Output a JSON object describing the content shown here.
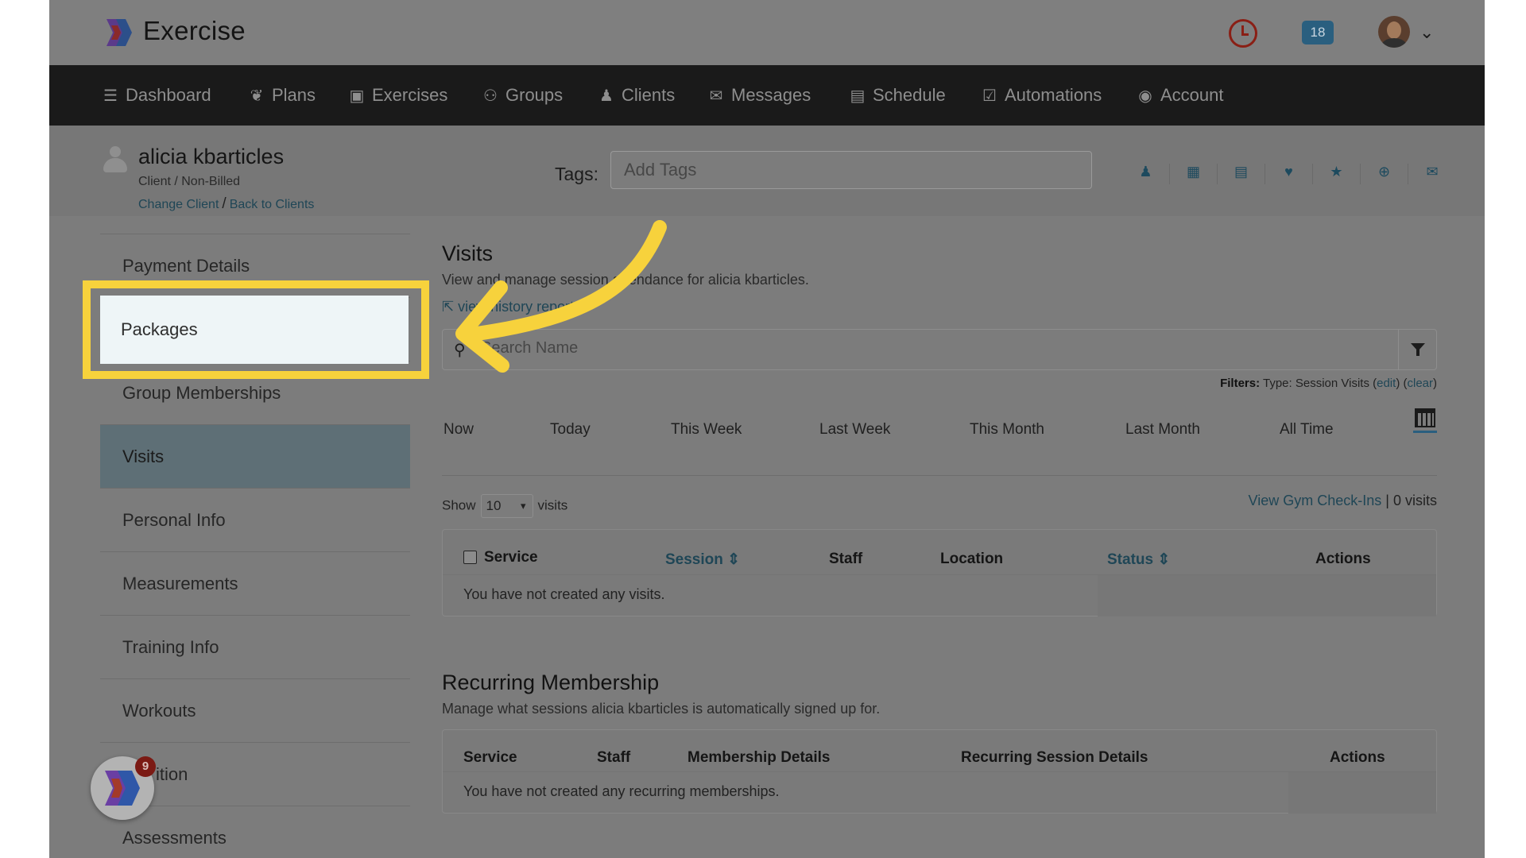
{
  "app": {
    "brand": "Exercise"
  },
  "topbar": {
    "notification_count": "18"
  },
  "nav": {
    "items": [
      {
        "label": "Dashboard",
        "icon": "list-icon"
      },
      {
        "label": "Plans",
        "icon": "bird-icon"
      },
      {
        "label": "Exercises",
        "icon": "dumbbell-icon"
      },
      {
        "label": "Groups",
        "icon": "users-icon"
      },
      {
        "label": "Clients",
        "icon": "user-icon"
      },
      {
        "label": "Messages",
        "icon": "envelope-icon"
      },
      {
        "label": "Schedule",
        "icon": "book-icon"
      },
      {
        "label": "Automations",
        "icon": "check-square-icon"
      },
      {
        "label": "Account",
        "icon": "user-circle-icon"
      }
    ]
  },
  "client": {
    "name": "alicia kbarticles",
    "type": "Client / Non-Billed",
    "change_link": "Change Client",
    "separator": "/",
    "back_link": "Back to Clients",
    "tags_label": "Tags:",
    "tags_placeholder": "Add Tags"
  },
  "sidebar": {
    "items": [
      {
        "label": "Payment Details"
      },
      {
        "label": "Packages"
      },
      {
        "label": "Group Memberships"
      },
      {
        "label": "Visits"
      },
      {
        "label": "Personal Info"
      },
      {
        "label": "Measurements"
      },
      {
        "label": "Training Info"
      },
      {
        "label": "Workouts"
      },
      {
        "label": "ition"
      },
      {
        "label": "Assessments"
      }
    ],
    "active": "Visits",
    "highlighted": "Packages"
  },
  "visits": {
    "title": "Visits",
    "description": "View and manage session attendance for alicia kbarticles.",
    "history_link": "view history report",
    "search_placeholder": "Search Name",
    "filters_label": "Filters:",
    "filters_value": "Type: Session Visits",
    "filters_edit": "edit",
    "filters_clear": "clear",
    "ranges": [
      "Now",
      "Today",
      "This Week",
      "Last Week",
      "This Month",
      "Last Month",
      "All Time"
    ],
    "show_label": "Show",
    "show_value": "10",
    "show_suffix": "visits",
    "gym_link": "View Gym Check-Ins",
    "gym_sep": "|",
    "visit_count": "0 visits",
    "columns": [
      "Service",
      "Session",
      "Staff",
      "Location",
      "Status",
      "Actions"
    ],
    "empty": "You have not created any visits."
  },
  "recurring": {
    "title": "Recurring Membership",
    "description": "Manage what sessions alicia kbarticles is automatically signed up for.",
    "columns": [
      "Service",
      "Staff",
      "Membership Details",
      "Recurring Session Details",
      "Actions"
    ],
    "empty": "You have not created any recurring memberships."
  },
  "widget": {
    "badge": "9"
  },
  "colors": {
    "highlight": "#f7d23c",
    "link": "#1f4656",
    "nav": "#1a1a1a",
    "badge": "#2a5f7f"
  }
}
